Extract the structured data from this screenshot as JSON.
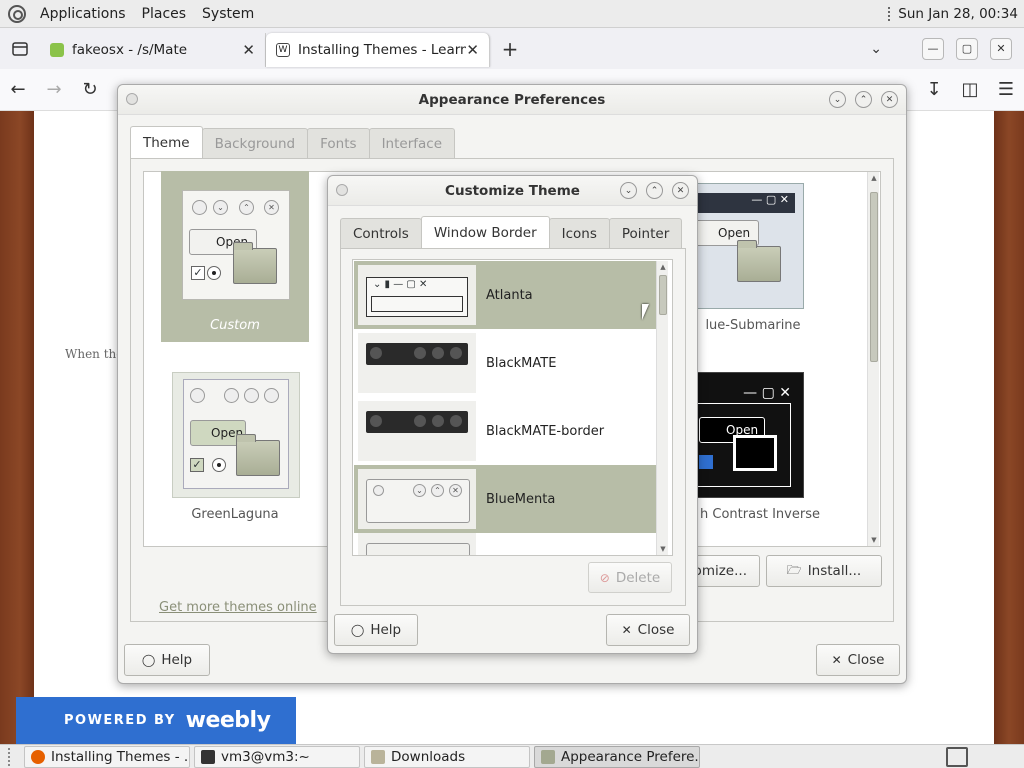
{
  "top_panel": {
    "menus": [
      "Applications",
      "Places",
      "System"
    ],
    "clock": "Sun Jan 28, 00:34"
  },
  "browser": {
    "tabs": [
      {
        "title": "fakeosx - /s/Mate",
        "favicon_color": "#8bc34a"
      },
      {
        "title": "Installing Themes - Learn Ub",
        "favicon_color": "#444444"
      }
    ]
  },
  "webpage": {
    "snippet_text": "When the",
    "footer_powered": "POWERED BY",
    "footer_brand": "weebly"
  },
  "taskbar": {
    "items": [
      {
        "label": "Installing Themes - ...",
        "icon_color": "#e66000"
      },
      {
        "label": "vm3@vm3:~",
        "icon_color": "#333333"
      },
      {
        "label": "Downloads",
        "icon_color": "#b9b39a"
      },
      {
        "label": "Appearance Prefere...",
        "icon_color": "#a3a890"
      }
    ]
  },
  "appearance": {
    "title": "Appearance Preferences",
    "tabs": [
      "Theme",
      "Background",
      "Fonts",
      "Interface"
    ],
    "themes": [
      {
        "name": "Custom"
      },
      {
        "name": "lue-Submarine"
      },
      {
        "name": "GreenLaguna"
      },
      {
        "name": "h Contrast Inverse"
      }
    ],
    "thumb_open_label": "Open",
    "get_more_link": "Get more themes online",
    "customize_label": "tomize...",
    "install_label": "Install...",
    "help_label": "Help",
    "close_label": "Close"
  },
  "customize": {
    "title": "Customize Theme",
    "tabs": [
      "Controls",
      "Window Border",
      "Icons",
      "Pointer"
    ],
    "borders": [
      {
        "name": "Atlanta"
      },
      {
        "name": "BlackMATE"
      },
      {
        "name": "BlackMATE-border"
      },
      {
        "name": "BlueMenta"
      }
    ],
    "delete_label": "Delete",
    "help_label": "Help",
    "close_label": "Close"
  },
  "colors": {
    "selection": "#b7bda7",
    "weebly_blue": "#2f6fd0",
    "wood": "#7a3a1e"
  }
}
